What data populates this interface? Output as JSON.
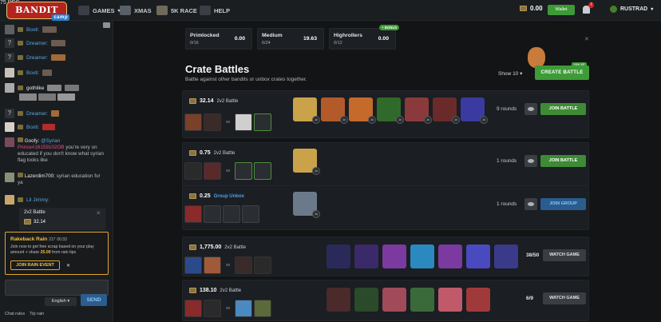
{
  "header": {
    "logo_text": "BANDIT",
    "logo_sub": "camp",
    "nav": [
      "GAMES",
      "XMAS",
      "5K RACE",
      "HELP"
    ],
    "race_badge": "75 DEC",
    "balance": "0.00",
    "wallet_label": "Wallet",
    "notifications": "7",
    "username": "RUSTRAD"
  },
  "chat": {
    "messages": [
      {
        "name": "Boxti:",
        "text": ""
      },
      {
        "name": "Dreamer:",
        "text": ""
      },
      {
        "name": "Dreamer:",
        "text": ""
      },
      {
        "name": "Boxti:",
        "text": ""
      },
      {
        "name": "gothlike",
        "text": ""
      },
      {
        "name": "Dreamer:",
        "text": ""
      },
      {
        "name": "Boxti:",
        "text": ""
      },
      {
        "name": "Goofy:",
        "mention": "@Syrian",
        "mention2": "Prince#16159102OB",
        "text": " you're very un educated if you don't know what syrian flag looks like"
      },
      {
        "name": "Lazerdim700:",
        "text": "syrian education for ya"
      },
      {
        "name": "Lil Jimmy:",
        "text": ""
      }
    ],
    "battle_card": {
      "title": "2v2 Battle",
      "price": "32.14"
    },
    "rake": {
      "title": "Rakeback Rain",
      "amount": "217",
      "timer": "00:33",
      "desc": "Join now to get free scrap based on your play amount + share",
      "reward": "25.00",
      "desc_end": "from rain tips",
      "join_label": "JOIN RAIN EVENT"
    },
    "lang": "English",
    "send_label": "SEND",
    "bottom": [
      "Chat rules",
      "Tip rain"
    ]
  },
  "tabs": [
    {
      "name": "Primlocked",
      "count": "0/16",
      "value": "0.00"
    },
    {
      "name": "Medium",
      "count": "6/24",
      "value": "19.63"
    },
    {
      "name": "Highrollers",
      "count": "0/12",
      "value": "0.00"
    }
  ],
  "bonus_label": "+ BONUS",
  "page": {
    "title": "Crate Battles",
    "subtitle": "Battle against other bandits or unbox crates together.",
    "show": "Show 10",
    "create_label": "CREATE BATTLE",
    "xp_badge": "+5% XP"
  },
  "rows": [
    {
      "price": "32.14",
      "type": "2v2 Battle",
      "rounds": "9 rounds",
      "action": "JOIN BATTLE",
      "crate_count": "1x"
    },
    {
      "price": "0.75",
      "type": "2v2 Battle",
      "rounds": "1 rounds",
      "action": "JOIN BATTLE",
      "crate_count": "1x"
    },
    {
      "price": "0.25",
      "type": "Group Unbox",
      "rounds": "1 rounds",
      "action": "JOIN GROUP",
      "crate_count": "1x"
    },
    {
      "price": "1,775.00",
      "type": "2v2 Battle",
      "rounds": "38/50",
      "action": "WATCH GAME"
    },
    {
      "price": "138.10",
      "type": "2v2 Battle",
      "rounds": "6/9",
      "action": "WATCH GAME"
    }
  ],
  "vs_label": "vs",
  "colors": {
    "accent_green": "#3e9b38",
    "chat_name": "#58a6e0",
    "rake_gold": "#e1a531"
  }
}
